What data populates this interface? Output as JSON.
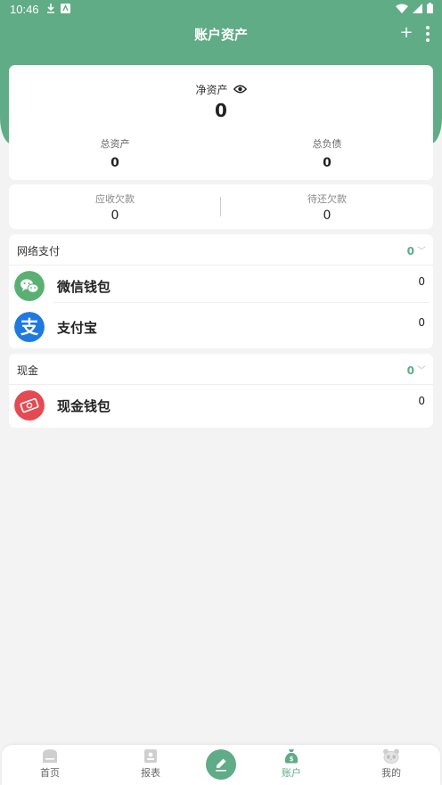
{
  "status": {
    "time": "10:46"
  },
  "header": {
    "title": "账户资产",
    "plus_label": "+"
  },
  "summary": {
    "net_label": "净资产",
    "net_value": "0",
    "total_assets_label": "总资产",
    "total_assets_value": "0",
    "total_liabilities_label": "总负债",
    "total_liabilities_value": "0"
  },
  "debts": {
    "receivable_label": "应收欠款",
    "receivable_value": "0",
    "payable_label": "待还欠款",
    "payable_value": "0"
  },
  "groups": [
    {
      "name": "网络支付",
      "total": "0",
      "accounts": [
        {
          "name": "微信钱包",
          "value": "0",
          "icon": "wechat-icon",
          "color": "#5ab073"
        },
        {
          "name": "支付宝",
          "value": "0",
          "icon": "alipay-icon",
          "color": "#1f7ae0"
        }
      ]
    },
    {
      "name": "现金",
      "total": "0",
      "accounts": [
        {
          "name": "现金钱包",
          "value": "0",
          "icon": "cash-wallet-icon",
          "color": "#e54a52"
        }
      ]
    }
  ],
  "nav": [
    {
      "label": "首页",
      "icon": "home-icon"
    },
    {
      "label": "报表",
      "icon": "report-icon"
    },
    {
      "label": "",
      "icon": "edit-icon"
    },
    {
      "label": "账户",
      "icon": "money-bag-icon"
    },
    {
      "label": "我的",
      "icon": "panda-icon"
    }
  ],
  "colors": {
    "brand": "#5fac86",
    "background": "#f3f3f3"
  }
}
